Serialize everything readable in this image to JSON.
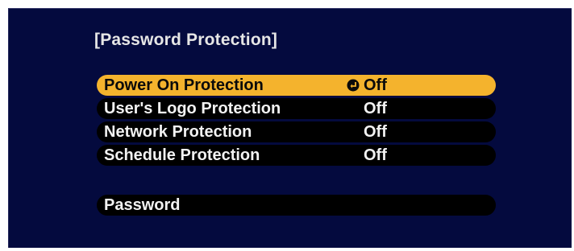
{
  "panel": {
    "title": "[Password Protection]"
  },
  "menu": {
    "items": [
      {
        "label": "Power On Protection",
        "value": "Off",
        "selected": true
      },
      {
        "label": "User's Logo Protection",
        "value": "Off",
        "selected": false
      },
      {
        "label": "Network Protection",
        "value": "Off",
        "selected": false
      },
      {
        "label": "Schedule Protection",
        "value": "Off",
        "selected": false
      }
    ],
    "password_label": "Password"
  },
  "icons": {
    "enter": "enter-icon"
  },
  "colors": {
    "background": "#040a3e",
    "row": "#000000",
    "highlight": "#f4b32d",
    "text": "#f2f2f2"
  }
}
